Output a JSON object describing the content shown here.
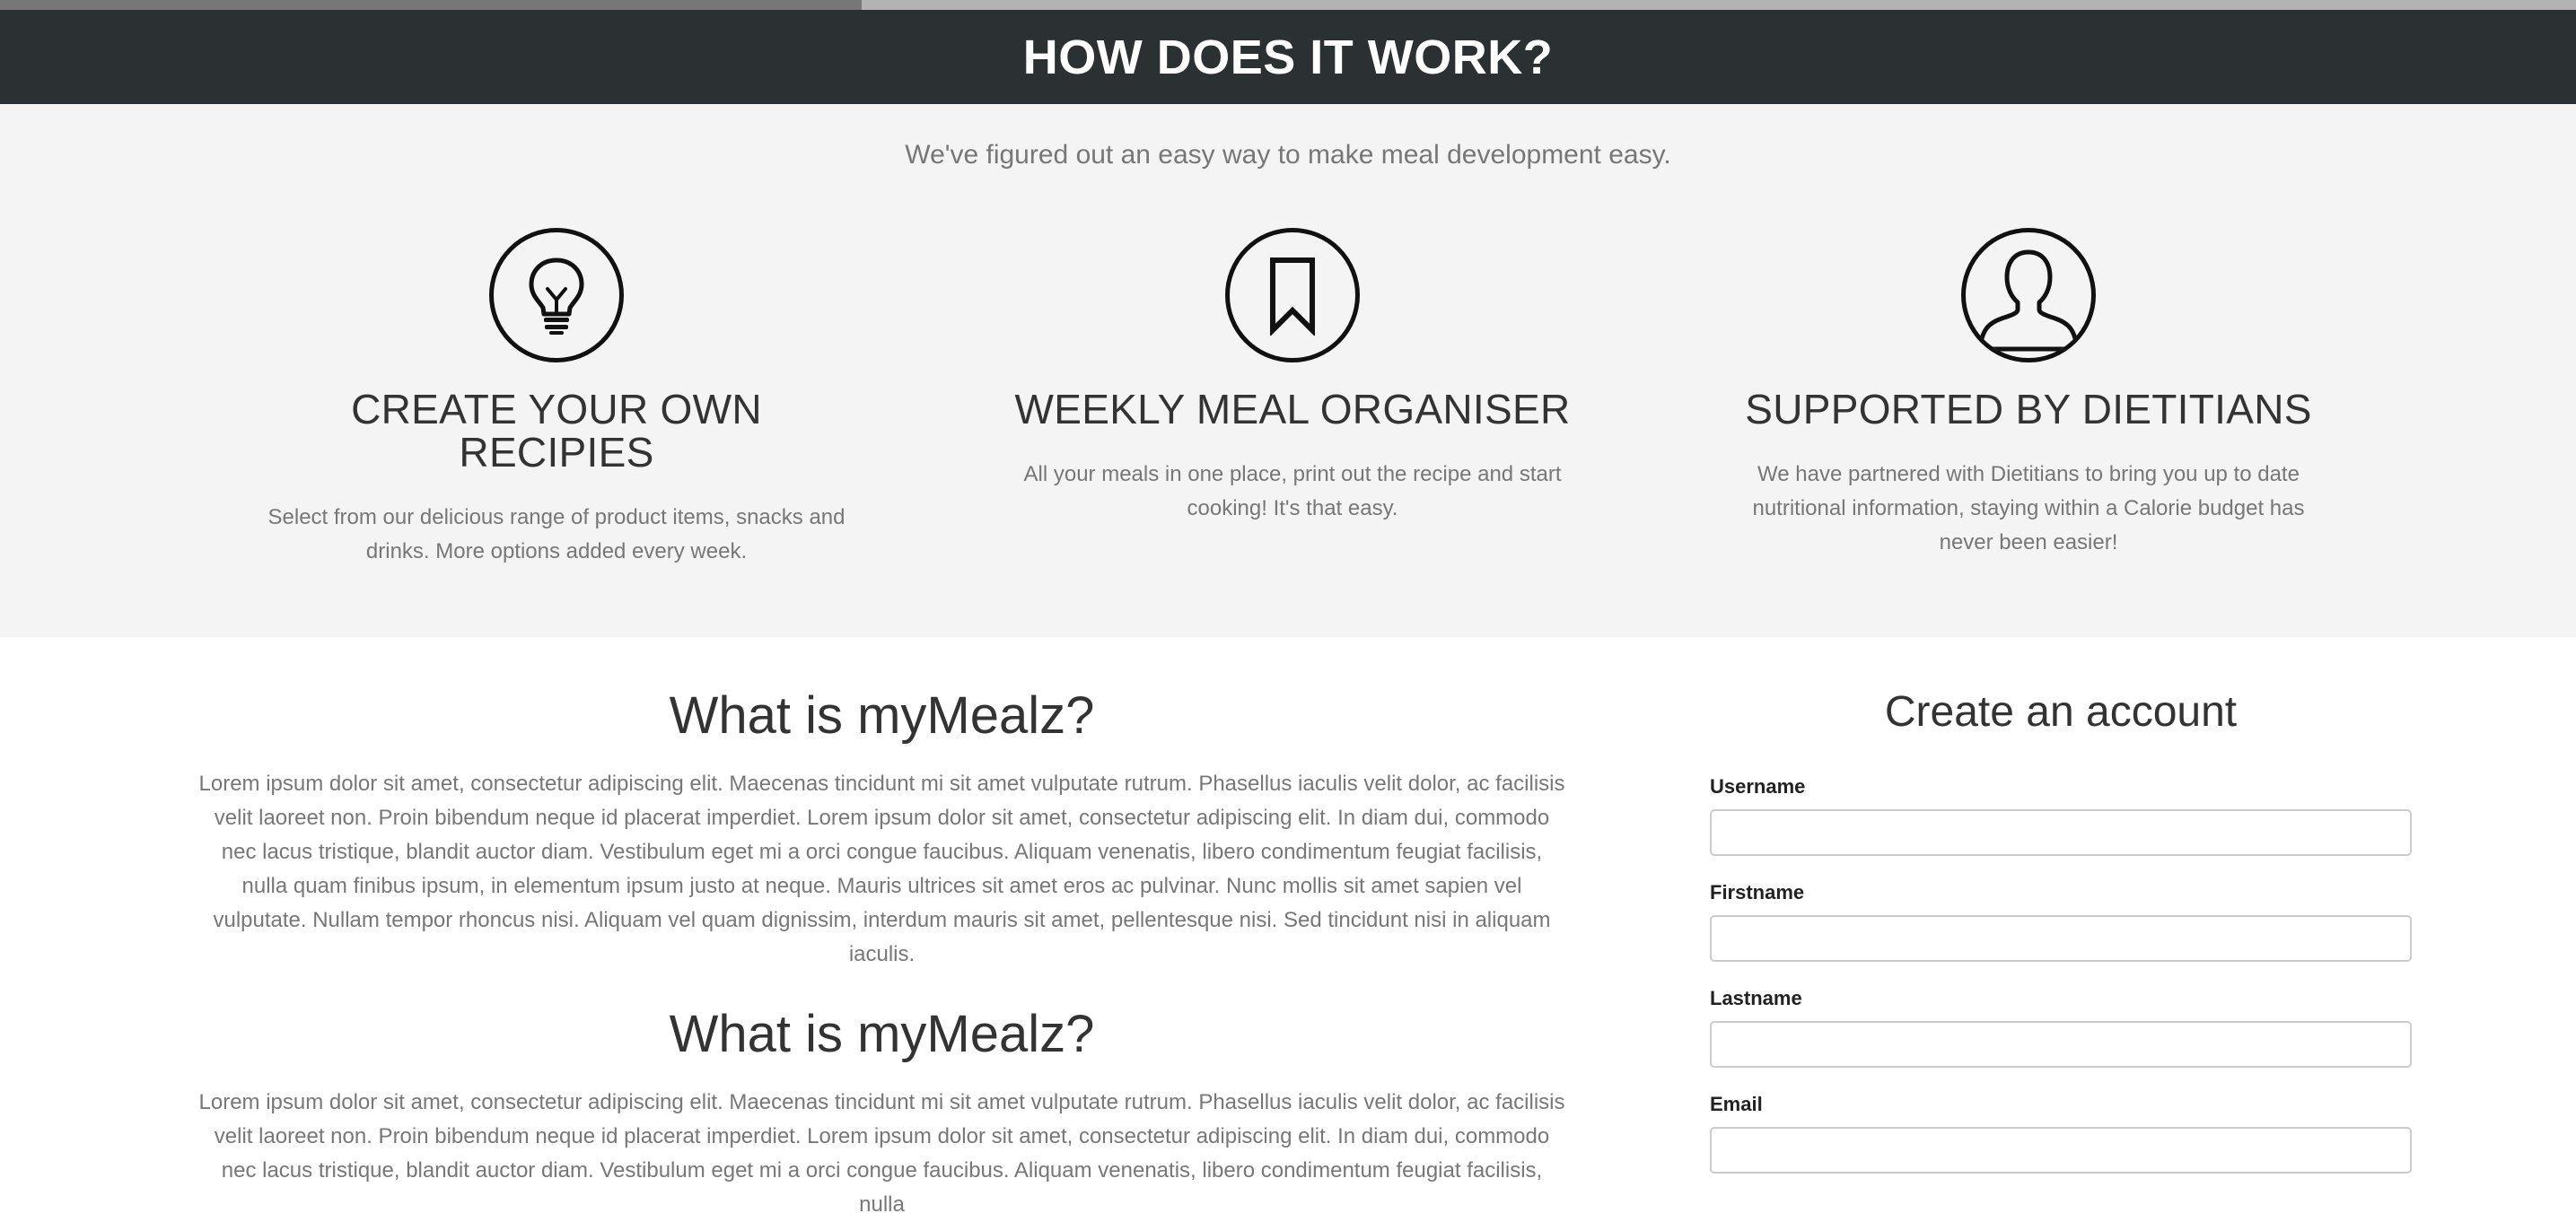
{
  "how": {
    "title": "HOW DOES IT WORK?",
    "subtitle": "We've figured out an easy way to make meal development easy."
  },
  "features": [
    {
      "icon": "lightbulb-icon",
      "title": "CREATE YOUR OWN RECIPIES",
      "text": "Select from our delicious range of product items, snacks and drinks. More options added every week."
    },
    {
      "icon": "bookmark-icon",
      "title": "WEEKLY MEAL ORGANISER",
      "text": "All your meals in one place, print out the recipe and start cooking! It's that easy."
    },
    {
      "icon": "user-icon",
      "title": "SUPPORTED BY DIETITIANS",
      "text": "We have partnered with Dietitians to bring you up to date nutritional information, staying within a Calorie budget has never been easier!"
    }
  ],
  "about": [
    {
      "title": "What is myMealz?",
      "text": "Lorem ipsum dolor sit amet, consectetur adipiscing elit. Maecenas tincidunt mi sit amet vulputate rutrum. Phasellus iaculis velit dolor, ac facilisis velit laoreet non. Proin bibendum neque id placerat imperdiet. Lorem ipsum dolor sit amet, consectetur adipiscing elit. In diam dui, commodo nec lacus tristique, blandit auctor diam. Vestibulum eget mi a orci congue faucibus. Aliquam venenatis, libero condimentum feugiat facilisis, nulla quam finibus ipsum, in elementum ipsum justo at neque. Mauris ultrices sit amet eros ac pulvinar. Nunc mollis sit amet sapien vel vulputate. Nullam tempor rhoncus nisi. Aliquam vel quam dignissim, interdum mauris sit amet, pellentesque nisi. Sed tincidunt nisi in aliquam iaculis."
    },
    {
      "title": "What is myMealz?",
      "text": "Lorem ipsum dolor sit amet, consectetur adipiscing elit. Maecenas tincidunt mi sit amet vulputate rutrum. Phasellus iaculis velit dolor, ac facilisis velit laoreet non. Proin bibendum neque id placerat imperdiet. Lorem ipsum dolor sit amet, consectetur adipiscing elit. In diam dui, commodo nec lacus tristique, blandit auctor diam. Vestibulum eget mi a orci congue faucibus. Aliquam venenatis, libero condimentum feugiat facilisis, nulla"
    }
  ],
  "signup": {
    "title": "Create an account",
    "fields": [
      {
        "label": "Username",
        "value": ""
      },
      {
        "label": "Firstname",
        "value": ""
      },
      {
        "label": "Lastname",
        "value": ""
      },
      {
        "label": "Email",
        "value": ""
      }
    ]
  },
  "colors": {
    "header_bg": "#2b3033",
    "features_bg": "#f4f4f4",
    "muted_text": "#777777"
  }
}
